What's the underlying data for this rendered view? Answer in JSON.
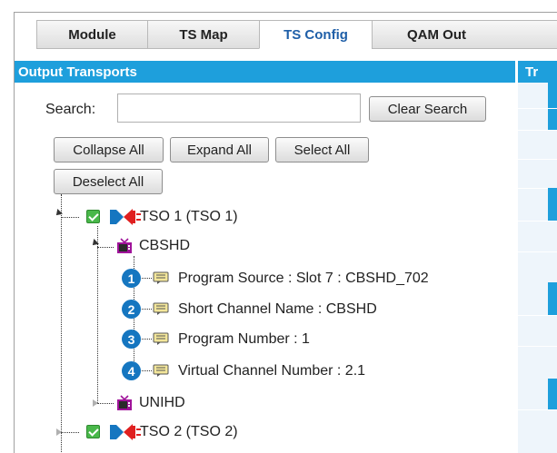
{
  "tabs": [
    {
      "label": "Module"
    },
    {
      "label": "TS Map"
    },
    {
      "label": "TS Config",
      "active": true
    },
    {
      "label": "QAM Out"
    }
  ],
  "panel": {
    "title": "Output Transports",
    "right_title": "Tr"
  },
  "search": {
    "label": "Search:",
    "value": "",
    "placeholder": "",
    "clear_label": "Clear Search"
  },
  "toolbar": {
    "collapse_all": "Collapse All",
    "expand_all": "Expand All",
    "select_all": "Select All",
    "deselect_all": "Deselect All"
  },
  "tree": {
    "tso1": {
      "label": "TSO 1 (TSO 1)",
      "checked": true,
      "expanded": true
    },
    "cbshd": {
      "label": "CBSHD",
      "expanded": true
    },
    "properties": [
      {
        "badge": "1",
        "label": "Program Source : Slot 7 : CBSHD_702"
      },
      {
        "badge": "2",
        "label": "Short Channel Name : CBSHD"
      },
      {
        "badge": "3",
        "label": "Program Number : 1"
      },
      {
        "badge": "4",
        "label": "Virtual Channel Number : 2.1"
      }
    ],
    "unihd": {
      "label": "UNIHD",
      "expanded": false
    },
    "tso2": {
      "label": "TSO 2 (TSO 2)",
      "checked": true,
      "expanded": false
    }
  },
  "colors": {
    "header": "#1e9fdc",
    "active_tab_text": "#1f5fa8",
    "badge": "#1576c0",
    "check": "#49b84a",
    "tv_icon": "#a0139a",
    "transport_icon": "#e02020"
  }
}
